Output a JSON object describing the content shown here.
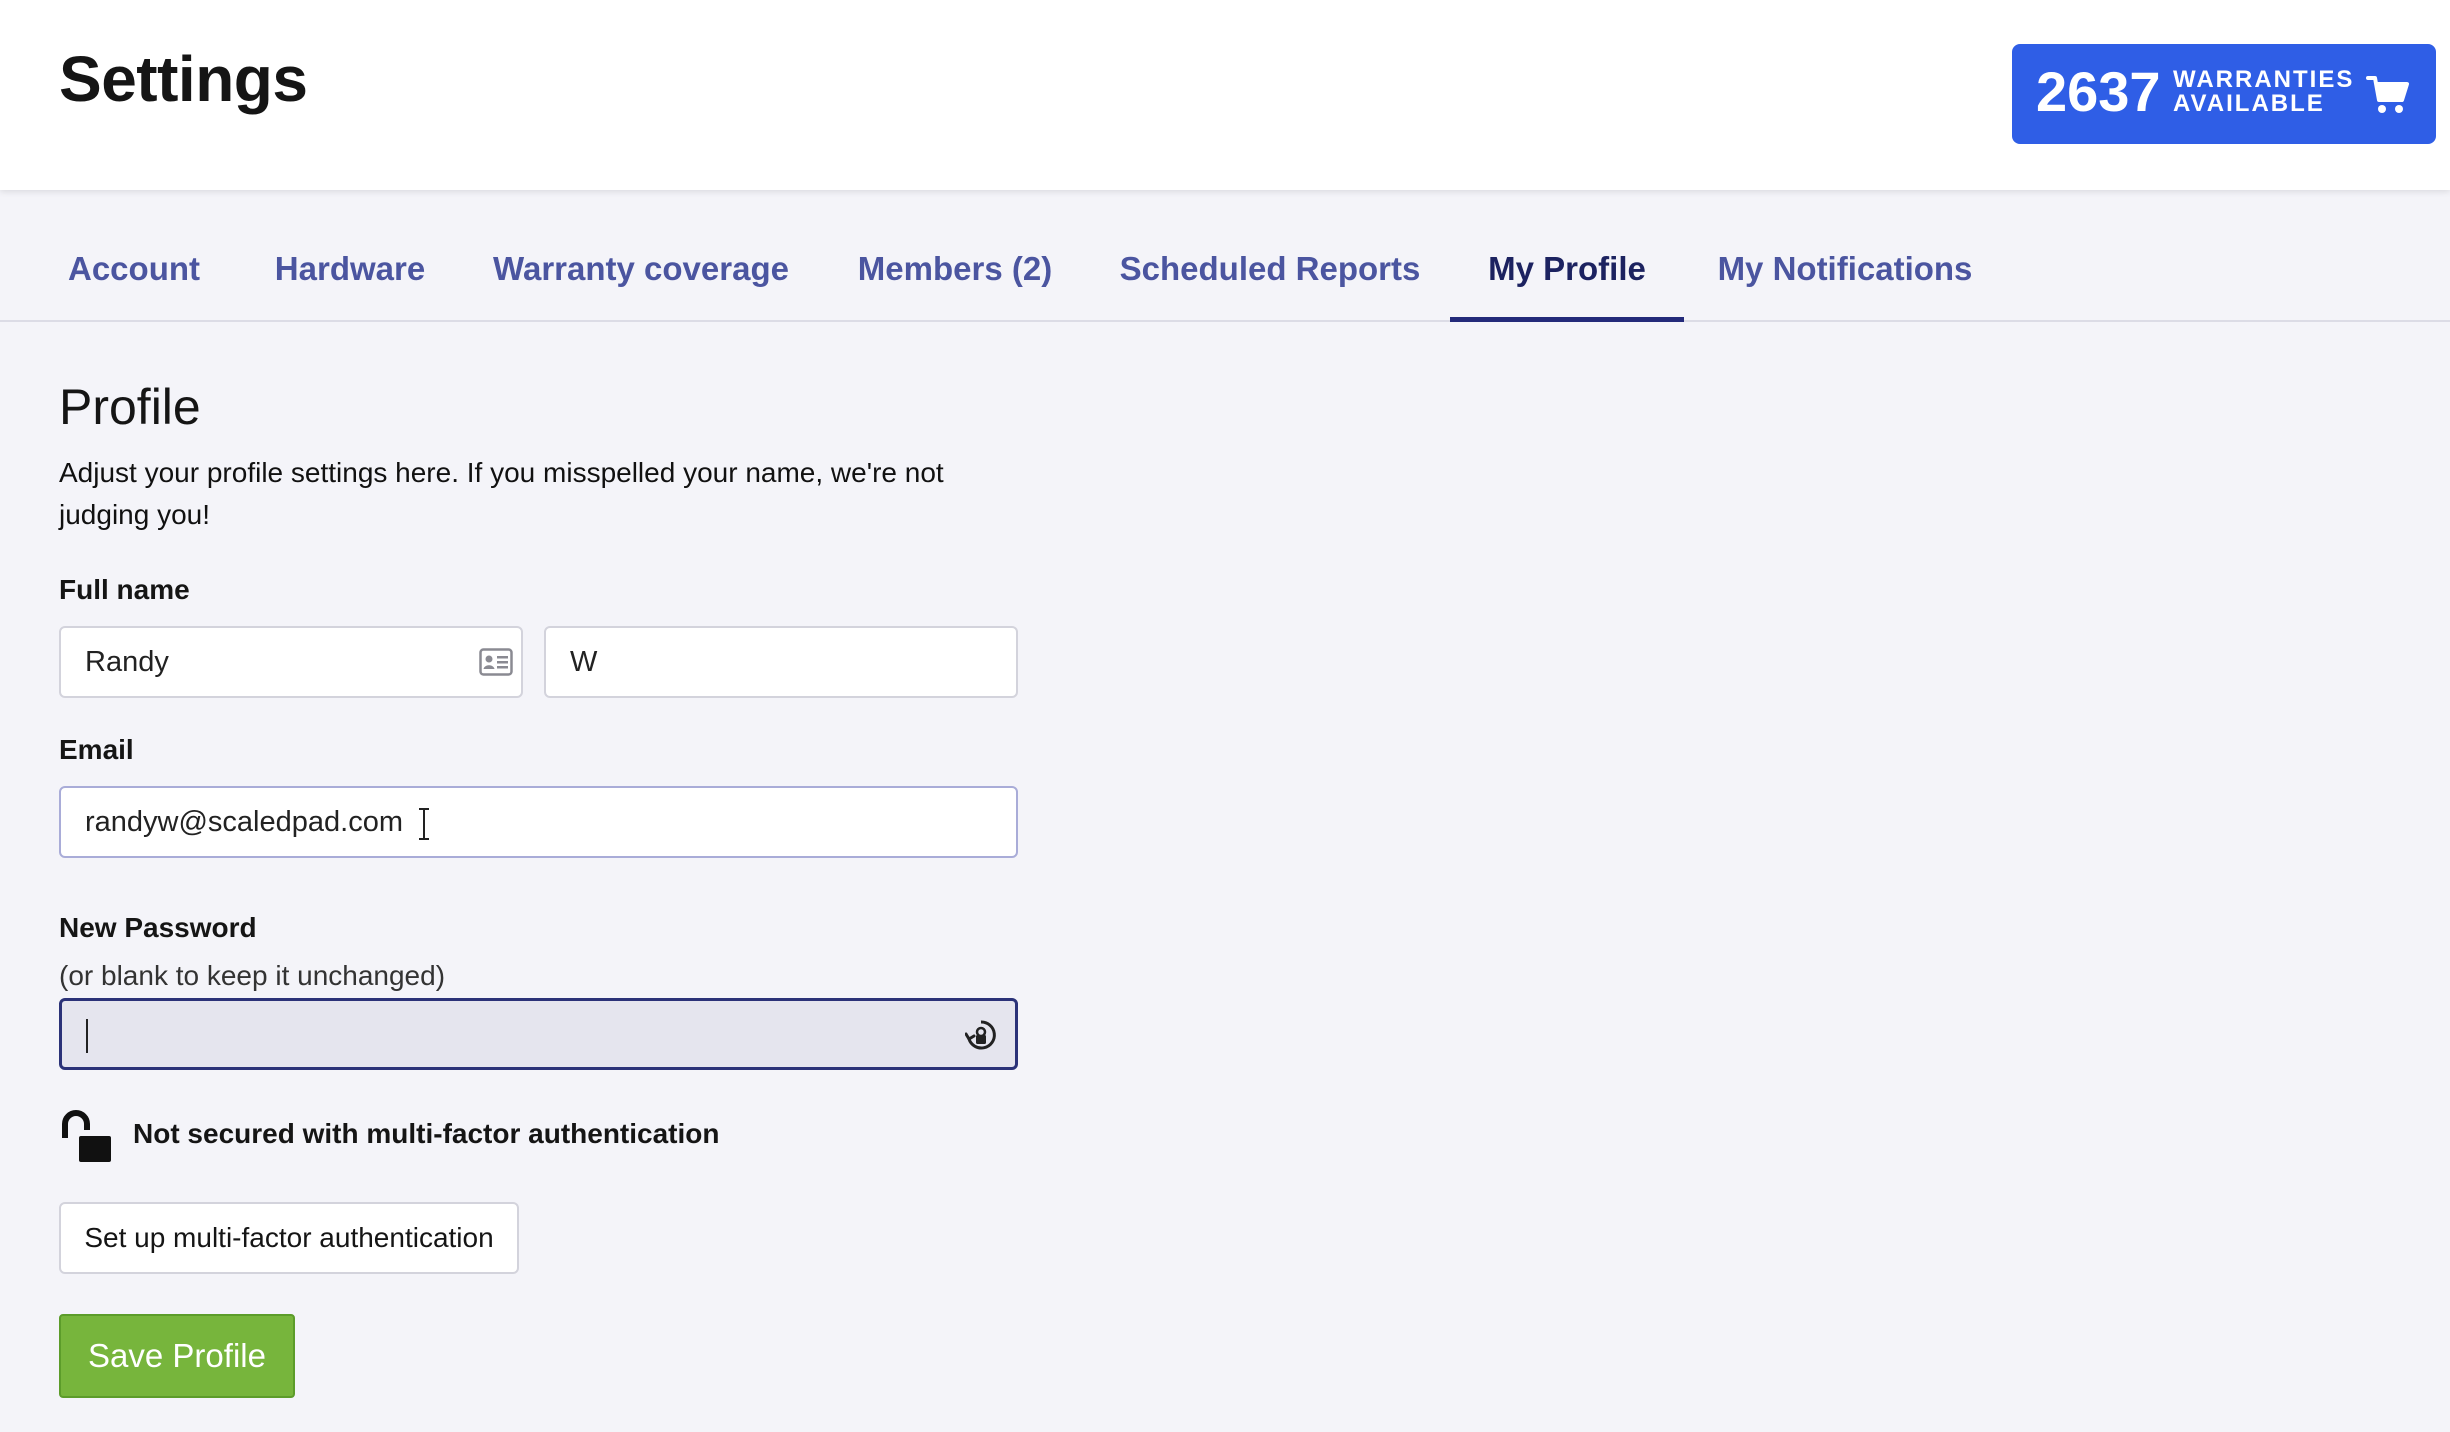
{
  "header": {
    "title": "Settings",
    "warranties": {
      "count": "2637",
      "label_line1": "WARRANTIES",
      "label_line2": "AVAILABLE",
      "icon": "cart-icon"
    }
  },
  "tabs": [
    {
      "label": "Account",
      "active": false
    },
    {
      "label": "Hardware",
      "active": false
    },
    {
      "label": "Warranty coverage",
      "active": false
    },
    {
      "label": "Members (2)",
      "active": false
    },
    {
      "label": "Scheduled Reports",
      "active": false
    },
    {
      "label": "My Profile",
      "active": true
    },
    {
      "label": "My Notifications",
      "active": false
    }
  ],
  "profile": {
    "title": "Profile",
    "description": "Adjust your profile settings here. If you misspelled your name, we're not judging you!",
    "full_name_label": "Full name",
    "first_name_value": "Randy",
    "last_name_value": "W",
    "email_label": "Email",
    "email_value": "randyw@scaledpad.com",
    "password_label": "New Password",
    "password_hint": "(or blank to keep it unchanged)",
    "password_value": "",
    "mfa_status": "Not secured with multi-factor authentication",
    "mfa_button": "Set up multi-factor authentication",
    "save_button": "Save Profile"
  },
  "colors": {
    "accent_blue": "#2f5ee6",
    "tab_text": "#4b55a0",
    "tab_active": "#1c2260",
    "save_green": "#77b53c",
    "page_background": "#f4f4f9"
  }
}
